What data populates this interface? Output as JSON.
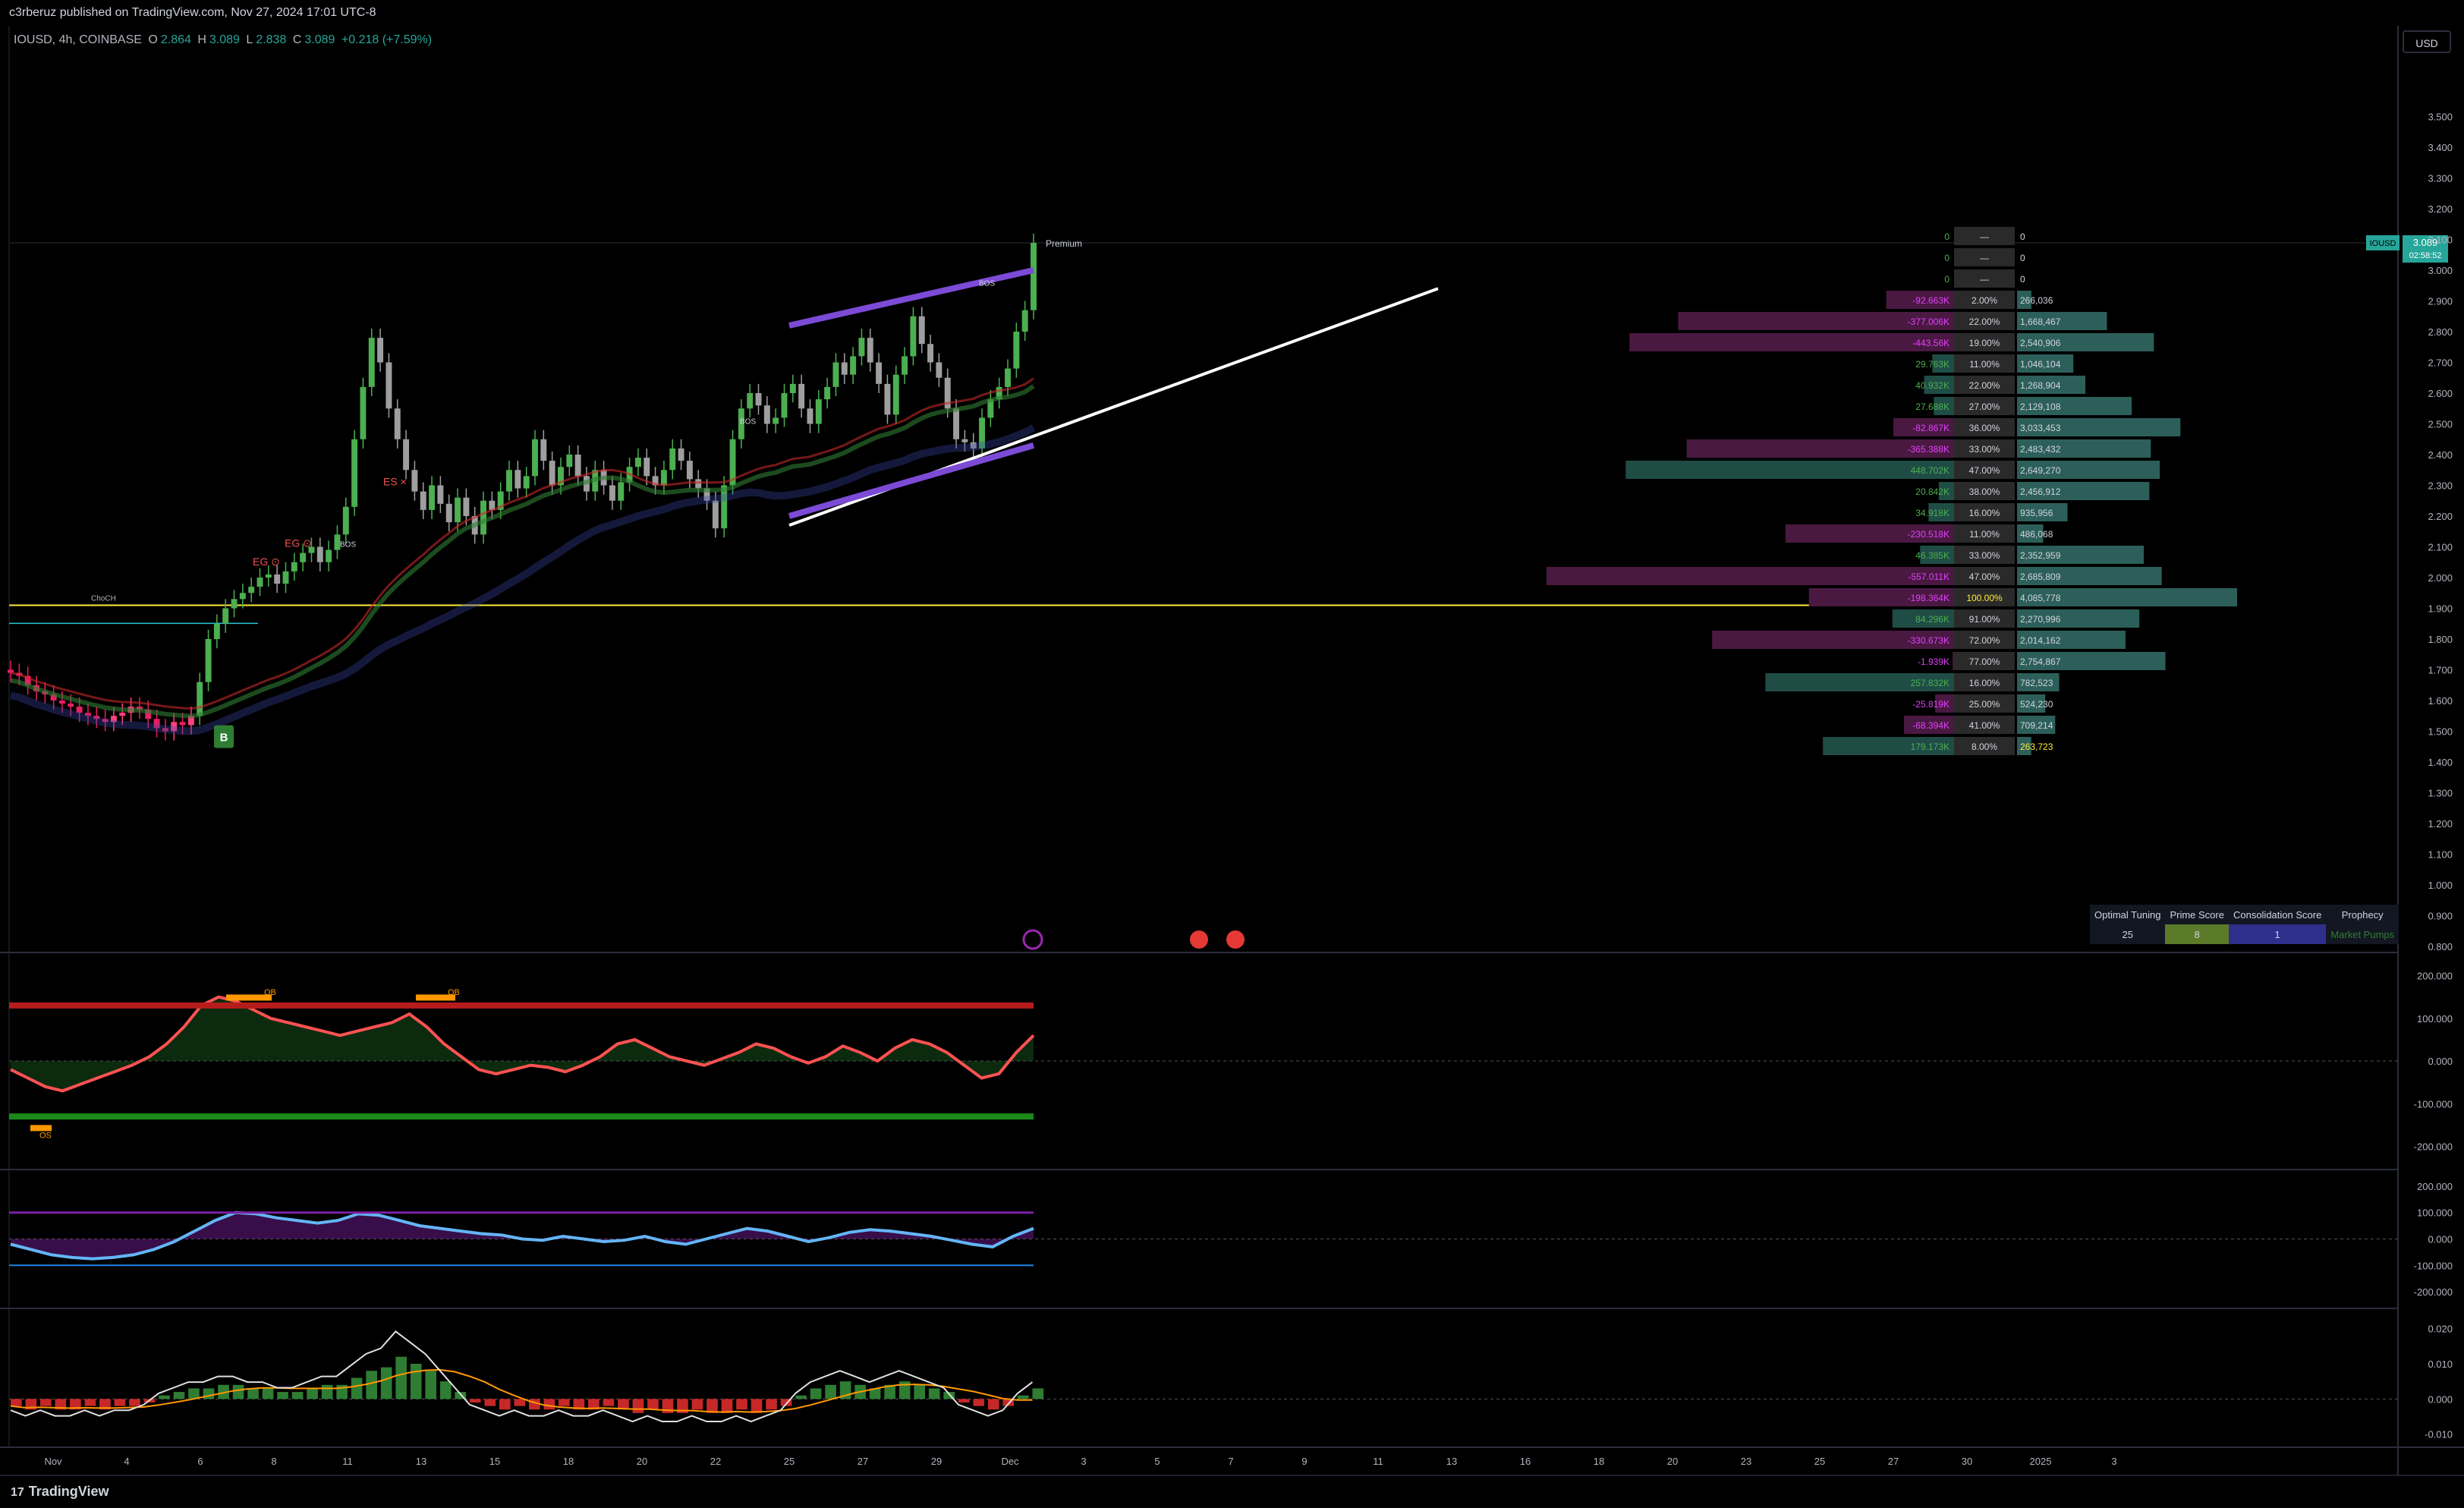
{
  "header": {
    "published": "c3rberuz published on TradingView.com, Nov 27, 2024 17:01 UTC-8"
  },
  "symbol": {
    "name": "IOUSD, 4h, COINBASE",
    "o_label": "O",
    "o": "2.864",
    "h_label": "H",
    "h": "3.089",
    "l_label": "L",
    "l": "2.838",
    "c_label": "C",
    "c": "3.089",
    "change": "+0.218 (+7.59%)"
  },
  "currency_button": "USD",
  "price_tag": {
    "ticker": "IOUSD",
    "price": "3.089",
    "countdown": "02:58:52"
  },
  "footer": {
    "brand": "TradingView",
    "mark": "17"
  },
  "colors": {
    "up": "#26a69a",
    "down": "#ef5350",
    "bull_candle": "#4caf50",
    "bear_candle": "#e91e63",
    "accent": "#ffeb3b",
    "purple": "#7b4bd6"
  },
  "labels": {
    "premium": "Premium",
    "choch": "ChoCH",
    "bos1": "BOS",
    "bos2": "BOS",
    "bos3": "BOS",
    "es": "ES ×",
    "eg1": "EG ⊙",
    "eg2": "EG ⊙",
    "buy_badge": "B",
    "ob1": "OB",
    "ob2": "OB",
    "os": "OS"
  },
  "score_table": {
    "headers": [
      "Optimal Tuning",
      "Prime Score",
      "Consolidation  Score",
      "Prophecy"
    ],
    "values": [
      "25",
      "8",
      "1",
      "Market Pumps"
    ]
  },
  "chart_data": [
    {
      "type": "candlestick",
      "title": "IOUSD, 4h, COINBASE",
      "x_ticks": [
        "Nov",
        "4",
        "6",
        "8",
        "11",
        "13",
        "15",
        "18",
        "20",
        "22",
        "25",
        "27",
        "29",
        "Dec",
        "3",
        "5",
        "7",
        "9",
        "11",
        "13",
        "16",
        "18",
        "20",
        "23",
        "25",
        "27",
        "30",
        "2025",
        "3"
      ],
      "ylim": [
        0.8,
        3.6
      ],
      "y_ticks": [
        "3.500",
        "3.400",
        "3.300",
        "3.200",
        "3.100",
        "3.000",
        "2.900",
        "2.800",
        "2.700",
        "2.600",
        "2.500",
        "2.400",
        "2.300",
        "2.200",
        "2.100",
        "2.000",
        "1.900",
        "1.800",
        "1.700",
        "1.600",
        "1.500",
        "1.400",
        "1.300",
        "1.200",
        "1.100",
        "1.000",
        "0.900",
        "0.800"
      ],
      "key_levels": {
        "premium": 3.089,
        "yellow_level": 1.91,
        "choch_level": 1.92
      },
      "close_series": [
        1.69,
        1.68,
        1.65,
        1.63,
        1.62,
        1.6,
        1.59,
        1.58,
        1.56,
        1.55,
        1.54,
        1.53,
        1.55,
        1.56,
        1.58,
        1.57,
        1.54,
        1.51,
        1.5,
        1.53,
        1.52,
        1.55,
        1.66,
        1.8,
        1.85,
        1.9,
        1.93,
        1.95,
        1.97,
        2.0,
        2.01,
        1.98,
        2.02,
        2.05,
        2.08,
        2.1,
        2.05,
        2.09,
        2.14,
        2.23,
        2.45,
        2.62,
        2.78,
        2.7,
        2.55,
        2.45,
        2.35,
        2.28,
        2.22,
        2.3,
        2.24,
        2.18,
        2.26,
        2.2,
        2.14,
        2.25,
        2.22,
        2.28,
        2.35,
        2.29,
        2.33,
        2.45,
        2.38,
        2.3,
        2.36,
        2.4,
        2.33,
        2.28,
        2.35,
        2.3,
        2.25,
        2.31,
        2.36,
        2.39,
        2.33,
        2.3,
        2.35,
        2.42,
        2.38,
        2.32,
        2.29,
        2.25,
        2.16,
        2.3,
        2.45,
        2.55,
        2.6,
        2.56,
        2.5,
        2.52,
        2.6,
        2.63,
        2.55,
        2.5,
        2.58,
        2.62,
        2.7,
        2.66,
        2.72,
        2.78,
        2.7,
        2.63,
        2.53,
        2.66,
        2.72,
        2.85,
        2.76,
        2.7,
        2.65,
        2.55,
        2.45,
        2.44,
        2.42,
        2.52,
        2.58,
        2.62,
        2.68,
        2.8,
        2.87,
        3.089
      ]
    },
    {
      "type": "table",
      "title": "Volume profile",
      "columns": [
        "delta",
        "percent",
        "volume"
      ],
      "rows": [
        [
          "0",
          "—",
          "0"
        ],
        [
          "0",
          "—",
          "0"
        ],
        [
          "0",
          "—",
          "0"
        ],
        [
          "-92.663K",
          "2.00%",
          "266,036"
        ],
        [
          "-377.006K",
          "22.00%",
          "1,668,467"
        ],
        [
          "-443.56K",
          "19.00%",
          "2,540,906"
        ],
        [
          "29.763K",
          "11.00%",
          "1,046,104"
        ],
        [
          "40.932K",
          "22.00%",
          "1,268,904"
        ],
        [
          "27.688K",
          "27.00%",
          "2,129,108"
        ],
        [
          "-82.867K",
          "36.00%",
          "3,033,453"
        ],
        [
          "-365.388K",
          "33.00%",
          "2,483,432"
        ],
        [
          "448.702K",
          "47.00%",
          "2,649,270"
        ],
        [
          "20.842K",
          "38.00%",
          "2,456,912"
        ],
        [
          "34.918K",
          "16.00%",
          "935,956"
        ],
        [
          "-230.518K",
          "11.00%",
          "486,068"
        ],
        [
          "46.385K",
          "33.00%",
          "2,352,959"
        ],
        [
          "-557.011K",
          "47.00%",
          "2,685,809"
        ],
        [
          "-198.364K",
          "100.00%",
          "4,085,778"
        ],
        [
          "84.296K",
          "91.00%",
          "2,270,996"
        ],
        [
          "-330.673K",
          "72.00%",
          "2,014,162"
        ],
        [
          "-1.939K",
          "77.00%",
          "2,754,867"
        ],
        [
          "257.832K",
          "16.00%",
          "782,523"
        ],
        [
          "-25.819K",
          "25.00%",
          "524,230"
        ],
        [
          "-68.394K",
          "41.00%",
          "709,214"
        ],
        [
          "179.173K",
          "8.00%",
          "263,723"
        ]
      ]
    },
    {
      "type": "line",
      "title": "Oscillator 1",
      "ylim": [
        -240,
        240
      ],
      "y_ticks": [
        "200.000",
        "100.000",
        "0.000",
        "-100.000",
        "-200.000"
      ],
      "values": [
        -20,
        -40,
        -60,
        -70,
        -55,
        -40,
        -25,
        -10,
        10,
        40,
        80,
        130,
        150,
        140,
        120,
        100,
        90,
        80,
        70,
        60,
        70,
        80,
        90,
        110,
        80,
        40,
        10,
        -20,
        -30,
        -20,
        -10,
        -15,
        -25,
        -10,
        10,
        40,
        50,
        30,
        10,
        0,
        -10,
        5,
        20,
        40,
        30,
        10,
        -5,
        10,
        35,
        20,
        0,
        30,
        50,
        40,
        20,
        -10,
        -40,
        -30,
        20,
        60
      ]
    },
    {
      "type": "line",
      "title": "Oscillator 2",
      "ylim": [
        -240,
        240
      ],
      "y_ticks": [
        "200.000",
        "100.000",
        "0.000",
        "-100.000",
        "-200.000"
      ],
      "values": [
        -20,
        -40,
        -60,
        -70,
        -75,
        -70,
        -60,
        -40,
        -10,
        30,
        70,
        100,
        95,
        80,
        70,
        60,
        70,
        95,
        90,
        70,
        50,
        40,
        30,
        20,
        15,
        0,
        -5,
        10,
        0,
        -10,
        -5,
        10,
        -10,
        -20,
        0,
        20,
        40,
        30,
        10,
        -10,
        5,
        25,
        35,
        30,
        20,
        10,
        -5,
        -20,
        -30,
        10,
        40
      ]
    },
    {
      "type": "bar",
      "title": "Histogram",
      "ylim": [
        -0.012,
        0.024
      ],
      "y_ticks": [
        "0.020",
        "0.010",
        "0.000",
        "-0.010"
      ],
      "values": [
        -0.002,
        -0.003,
        -0.002,
        -0.003,
        -0.003,
        -0.002,
        -0.003,
        -0.002,
        -0.002,
        -0.001,
        0.001,
        0.002,
        0.003,
        0.003,
        0.004,
        0.004,
        0.003,
        0.003,
        0.002,
        0.002,
        0.003,
        0.004,
        0.004,
        0.006,
        0.008,
        0.009,
        0.012,
        0.01,
        0.008,
        0.005,
        0.002,
        -0.001,
        -0.002,
        -0.003,
        -0.002,
        -0.003,
        -0.003,
        -0.002,
        -0.003,
        -0.003,
        -0.002,
        -0.003,
        -0.004,
        -0.003,
        -0.004,
        -0.004,
        -0.003,
        -0.004,
        -0.004,
        -0.003,
        -0.004,
        -0.003,
        -0.002,
        0.001,
        0.003,
        0.004,
        0.005,
        0.004,
        0.003,
        0.004,
        0.005,
        0.004,
        0.003,
        0.002,
        -0.001,
        -0.002,
        -0.003,
        -0.002,
        0.001,
        0.003
      ]
    }
  ]
}
